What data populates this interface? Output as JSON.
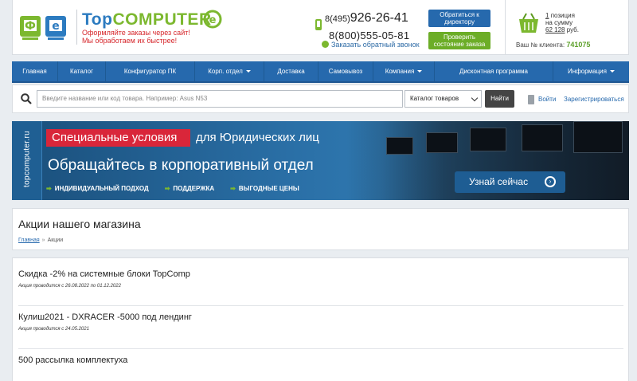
{
  "header": {
    "logo_text_blue": "Top",
    "logo_text_green": "COMPUTER",
    "slogan_line1": "Оформляйте заказы через сайт!",
    "slogan_line2": "Мы обработаем их быстрее!",
    "phone1_prefix": "8(495)",
    "phone1_number": "926-26-41",
    "phone2": "8(800)555-05-81",
    "callback_label": "Заказать обратный звонок",
    "director_button": "Обратиться к директору",
    "check_order_button": "Проверить состояние заказа",
    "cart_count": "1",
    "cart_items_label": "позиция",
    "cart_sum_label": "на сумму",
    "cart_sum": "62 128",
    "cart_currency": "руб.",
    "client_label": "Ваш № клиента:",
    "client_number": "741075",
    "colors": {
      "brand_blue": "#2669ad",
      "brand_green": "#7cb82f",
      "slogan_red": "#d6262b"
    }
  },
  "nav": {
    "items": [
      {
        "label": "Главная",
        "dropdown": false
      },
      {
        "label": "Каталог",
        "dropdown": false
      },
      {
        "label": "Конфигуратор ПК",
        "dropdown": false
      },
      {
        "label": "Корп. отдел",
        "dropdown": true
      },
      {
        "label": "Доставка",
        "dropdown": false
      },
      {
        "label": "Самовывоз",
        "dropdown": false
      },
      {
        "label": "Компания",
        "dropdown": true
      },
      {
        "label": "Дисконтная программа",
        "dropdown": false
      },
      {
        "label": "Информация",
        "dropdown": true
      }
    ]
  },
  "search": {
    "placeholder": "Введите название или код товара. Например: Asus N53",
    "scope_selected": "Каталог товаров",
    "find_button": "Найти",
    "login_link": "Войти",
    "register_link": "Зарегистрироваться"
  },
  "banner": {
    "side_text": "topcomputer.ru",
    "highlight": "Специальные условия",
    "legal": "для Юридических лиц",
    "headline": "Обращайтесь в корпоративный отдел",
    "points": [
      "ИНДИВИДУАЛЬНЫЙ ПОДХОД",
      "ПОДДЕРЖКА",
      "ВЫГОДНЫЕ ЦЕНЫ"
    ],
    "cta": "Узнай сейчас"
  },
  "page": {
    "title": "Акции нашего магазина",
    "breadcrumb_home": "Главная",
    "breadcrumb_current": "Акции"
  },
  "promos": [
    {
      "title": "Скидка -2% на системные блоки TopComp",
      "date": "Акция проводится с 26.08.2022 по 01.12.2022"
    },
    {
      "title": "Кулиш2021 - DXRACER -5000 под лендинг",
      "date": "Акция проводится с 24.05.2021"
    },
    {
      "title": "500 рассылка комплектуха",
      "date": ""
    }
  ]
}
